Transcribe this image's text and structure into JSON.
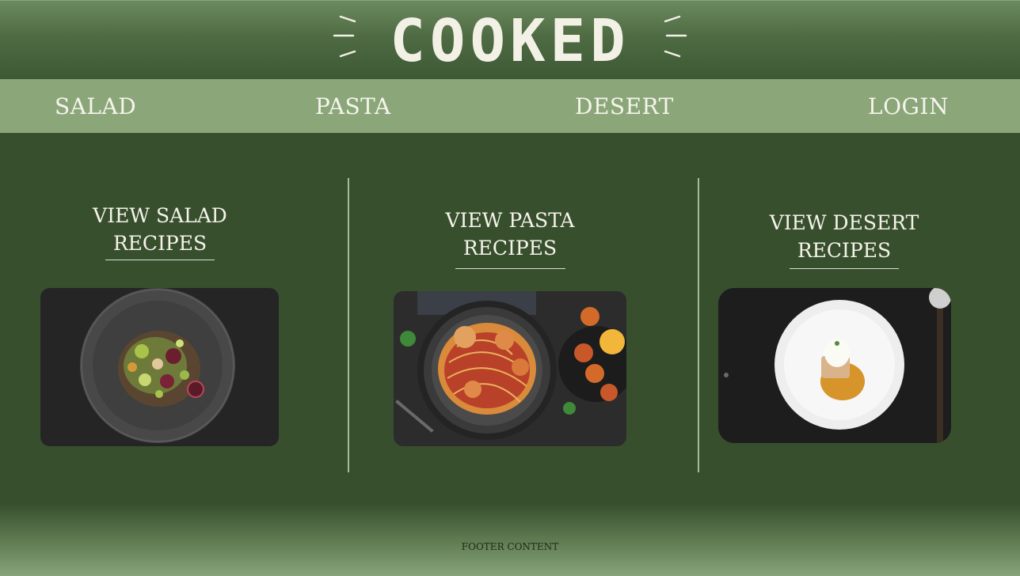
{
  "header": {
    "logo_text": "COOKED"
  },
  "nav": {
    "items": [
      {
        "label": "SALAD"
      },
      {
        "label": "PASTA"
      },
      {
        "label": "DESERT"
      },
      {
        "label": "LOGIN"
      }
    ]
  },
  "sections": [
    {
      "title_line1": "VIEW SALAD",
      "title_line2": "RECIPES",
      "image_icon": "salad-plate-image"
    },
    {
      "title_line1": "VIEW PASTA",
      "title_line2": "RECIPES",
      "image_icon": "pasta-plate-image"
    },
    {
      "title_line1": "VIEW DESERT",
      "title_line2": "RECIPES",
      "image_icon": "desert-plate-image"
    }
  ],
  "footer": {
    "text": "FOOTER CONTENT"
  },
  "colors": {
    "background": "#384f2e",
    "nav": "#8ba77a",
    "text": "#f5f3ea"
  }
}
